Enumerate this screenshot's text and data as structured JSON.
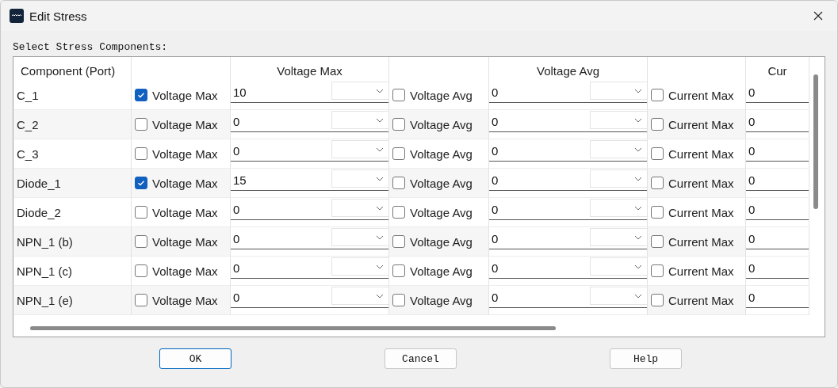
{
  "window": {
    "title": "Edit Stress"
  },
  "prompt": "Select Stress Components:",
  "table": {
    "columns": [
      {
        "kind": "text",
        "label": "Component (Port)"
      },
      {
        "kind": "check"
      },
      {
        "kind": "field",
        "label": "Voltage Max"
      },
      {
        "kind": "check"
      },
      {
        "kind": "field",
        "label": "Voltage Avg"
      },
      {
        "kind": "check"
      },
      {
        "kind": "field",
        "label": "Cur"
      }
    ],
    "rows": [
      {
        "component": "C_1",
        "stresses": [
          {
            "label": "Voltage Max",
            "checked": true,
            "value": "10"
          },
          {
            "label": "Voltage Avg",
            "checked": false,
            "value": "0"
          },
          {
            "label": "Current Max",
            "checked": false,
            "value": "0"
          }
        ]
      },
      {
        "component": "C_2",
        "stresses": [
          {
            "label": "Voltage Max",
            "checked": false,
            "value": "0"
          },
          {
            "label": "Voltage Avg",
            "checked": false,
            "value": "0"
          },
          {
            "label": "Current Max",
            "checked": false,
            "value": "0"
          }
        ]
      },
      {
        "component": "C_3",
        "stresses": [
          {
            "label": "Voltage Max",
            "checked": false,
            "value": "0"
          },
          {
            "label": "Voltage Avg",
            "checked": false,
            "value": "0"
          },
          {
            "label": "Current Max",
            "checked": false,
            "value": "0"
          }
        ]
      },
      {
        "component": "Diode_1",
        "stresses": [
          {
            "label": "Voltage Max",
            "checked": true,
            "value": "15"
          },
          {
            "label": "Voltage Avg",
            "checked": false,
            "value": "0"
          },
          {
            "label": "Current Max",
            "checked": false,
            "value": "0"
          }
        ]
      },
      {
        "component": "Diode_2",
        "stresses": [
          {
            "label": "Voltage Max",
            "checked": false,
            "value": "0"
          },
          {
            "label": "Voltage Avg",
            "checked": false,
            "value": "0"
          },
          {
            "label": "Current Max",
            "checked": false,
            "value": "0"
          }
        ]
      },
      {
        "component": "NPN_1 (b)",
        "stresses": [
          {
            "label": "Voltage Max",
            "checked": false,
            "value": "0"
          },
          {
            "label": "Voltage Avg",
            "checked": false,
            "value": "0"
          },
          {
            "label": "Current Max",
            "checked": false,
            "value": "0"
          }
        ]
      },
      {
        "component": "NPN_1 (c)",
        "stresses": [
          {
            "label": "Voltage Max",
            "checked": false,
            "value": "0"
          },
          {
            "label": "Voltage Avg",
            "checked": false,
            "value": "0"
          },
          {
            "label": "Current Max",
            "checked": false,
            "value": "0"
          }
        ]
      },
      {
        "component": "NPN_1 (e)",
        "stresses": [
          {
            "label": "Voltage Max",
            "checked": false,
            "value": "0"
          },
          {
            "label": "Voltage Avg",
            "checked": false,
            "value": "0"
          },
          {
            "label": "Current Max",
            "checked": false,
            "value": "0"
          }
        ]
      }
    ]
  },
  "buttons": [
    {
      "label": "OK",
      "selected": true
    },
    {
      "label": "Cancel",
      "selected": false
    },
    {
      "label": "Help",
      "selected": false
    }
  ]
}
